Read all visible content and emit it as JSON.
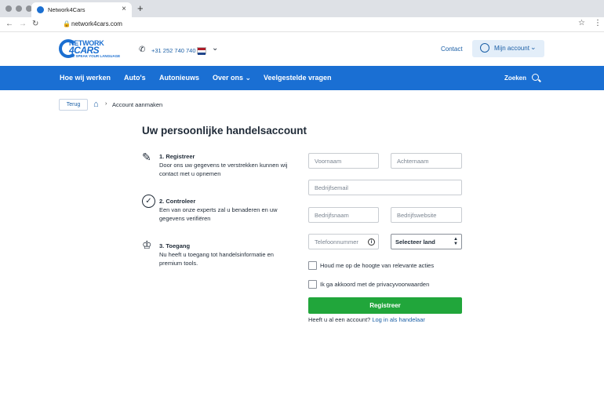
{
  "browser": {
    "tab_title": "Network4Cars",
    "url": "network4cars.com"
  },
  "header": {
    "logo_top": "NETWORK",
    "logo_main": "4CARS",
    "logo_sub": "WE SPEAK YOUR LANGUAGE",
    "phone": "+31 252 740 740",
    "contact": "Contact",
    "account": "Mijn account"
  },
  "nav": {
    "items": [
      "Hoe wij werken",
      "Auto's",
      "Autonieuws",
      "Over ons ⌄",
      "Veelgestelde vragen"
    ],
    "search": "Zoeken"
  },
  "breadcrumb": {
    "back": "Terug",
    "current": "Account aanmaken"
  },
  "page": {
    "title": "Uw persoonlijke handelsaccount"
  },
  "steps": [
    {
      "icon": "edit-icon",
      "title": "1. Registreer",
      "desc": "Door ons uw gegevens te verstrekken kunnen wij contact met u opnemen"
    },
    {
      "icon": "check-circle-icon",
      "title": "2. Controleer",
      "desc": "Een van onze experts zal u benaderen en uw gegevens verifiëren"
    },
    {
      "icon": "crown-hand-icon",
      "title": "3. Toegang",
      "desc": "Nu heeft u toegang tot handelsinformatie en premium tools."
    }
  ],
  "form": {
    "firstname": "Voornaam",
    "lastname": "Achternaam",
    "email": "Bedrijfsemail",
    "company": "Bedrijfsnaam",
    "website": "Bedrijfswebsite",
    "phone": "Telefoonnummer",
    "country": "Selecteer land",
    "newsletter": "Houd me op de hoogte van relevante acties",
    "privacy": "Ik ga akkoord met de privacyvoorwaarden",
    "submit": "Registreer",
    "login_question": "Heeft u al een account?",
    "login_link": "Log in als handelaar"
  },
  "colors": {
    "primary": "#1a6fd3",
    "success": "#21a63b"
  }
}
